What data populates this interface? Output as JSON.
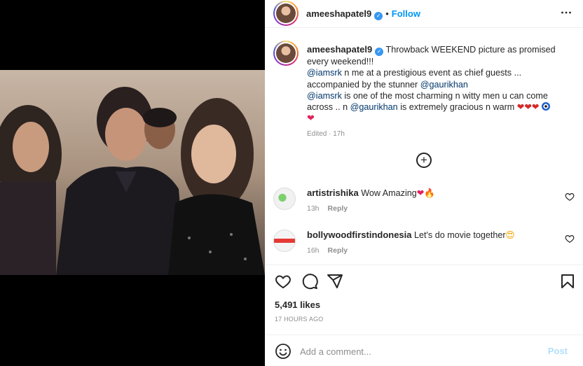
{
  "post": {
    "author": "ameeshapatel9",
    "follow_label": "Follow",
    "separator": "•",
    "more_label": "•••"
  },
  "caption": {
    "username": "ameeshapatel9",
    "line1": "Throwback WEEKEND picture as promised every weekend!!!",
    "mention_srk": "@iamsrk",
    "line2_rest": " n me at a prestigious event as chief guests ... accompanied by the stunner ",
    "mention_gauri": "@gaurikhan",
    "mention_srk2": "@iamsrk",
    "line3_rest": " is one of the most charming n witty men u can come across .. n ",
    "mention_gauri2": "@gaurikhan",
    "line3_end": " is extremely gracious n warm",
    "edited": "Edited · 17h"
  },
  "comments": [
    {
      "username": "artistrishika",
      "text": "Wow Amazing",
      "time": "13h",
      "reply": "Reply"
    },
    {
      "username": "bollywoodfirstindonesia",
      "text": "Let's do movie together",
      "time": "16h",
      "reply": "Reply"
    }
  ],
  "stats": {
    "likes": "5,491 likes",
    "time_ago": "17 HOURS AGO"
  },
  "composer": {
    "placeholder": "Add a comment...",
    "post_label": "Post"
  },
  "colors": {
    "link": "#0095f6",
    "mention": "#00376b",
    "verified": "#3897f0",
    "post_disabled": "#b2dffc"
  },
  "icons": [
    "more-icon",
    "verified-icon",
    "plus-circle-icon",
    "heart-icon",
    "comment-icon",
    "share-icon",
    "bookmark-icon",
    "emoji-icon"
  ]
}
